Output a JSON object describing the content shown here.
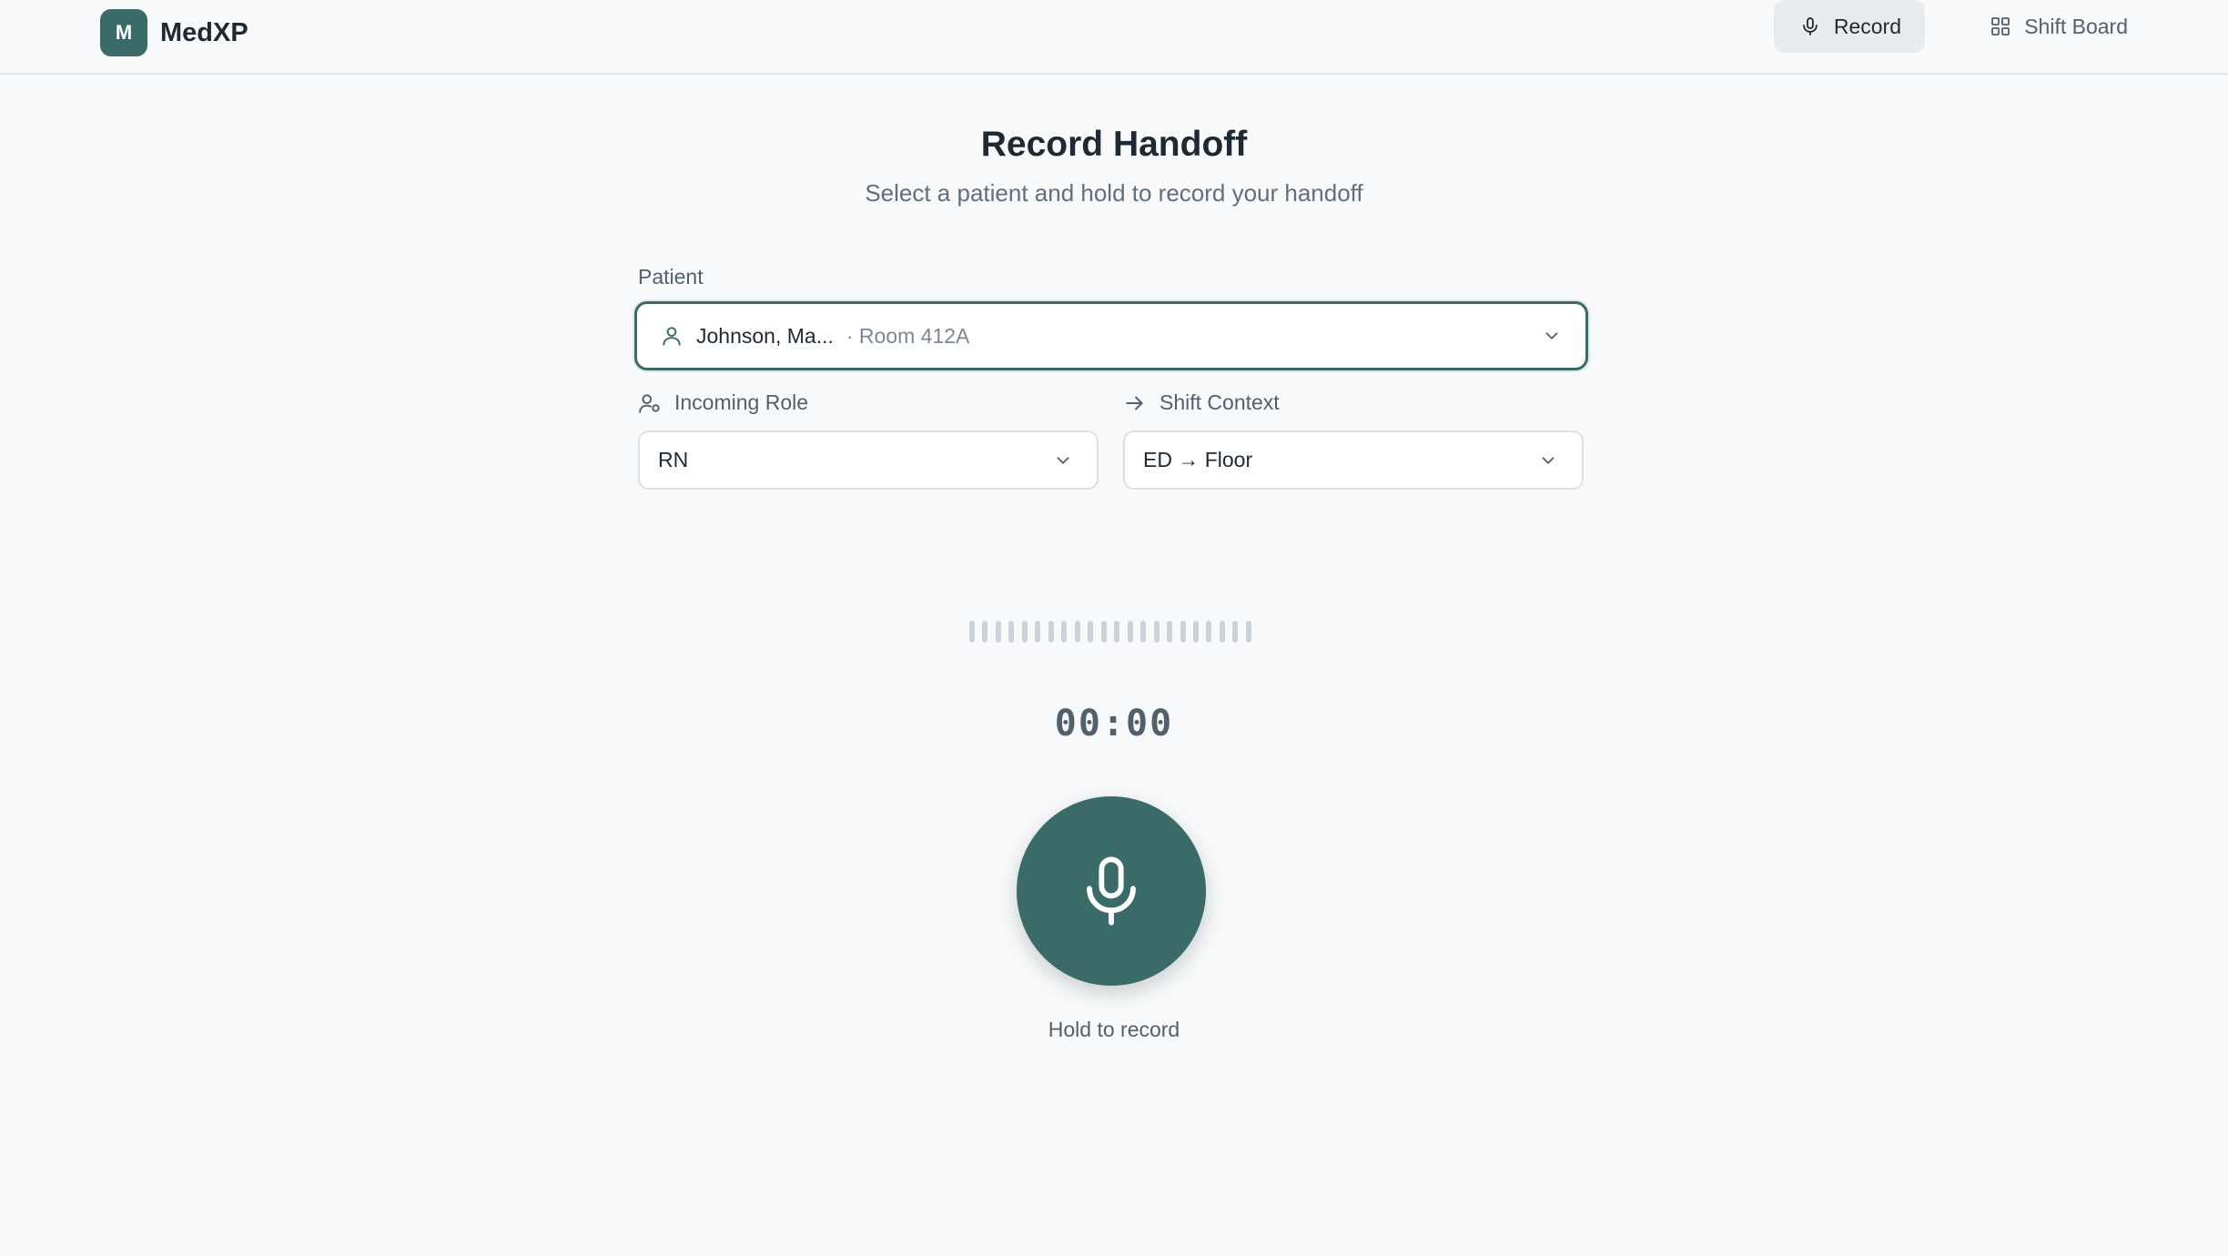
{
  "app": {
    "logo_letter": "M",
    "name": "MedXP"
  },
  "nav": {
    "record_label": "Record",
    "shift_board_label": "Shift Board",
    "active": "Record"
  },
  "main": {
    "title": "Record Handoff",
    "subtitle": "Select a patient and hold to record your handoff"
  },
  "patient": {
    "label": "Patient",
    "name": "Johnson, Ma...",
    "room": "· Room 412A"
  },
  "incoming_role": {
    "label": "Incoming Role",
    "value": "RN"
  },
  "shift_context": {
    "label": "Shift Context",
    "value": "ED → Floor"
  },
  "recorder": {
    "timer": "00:00",
    "hint": "Hold to record",
    "waveform_bar_count": 22
  },
  "colors": {
    "accent": "#3a6b69",
    "background": "#f8f9fa",
    "waveform_idle": "#cbd2d9"
  }
}
